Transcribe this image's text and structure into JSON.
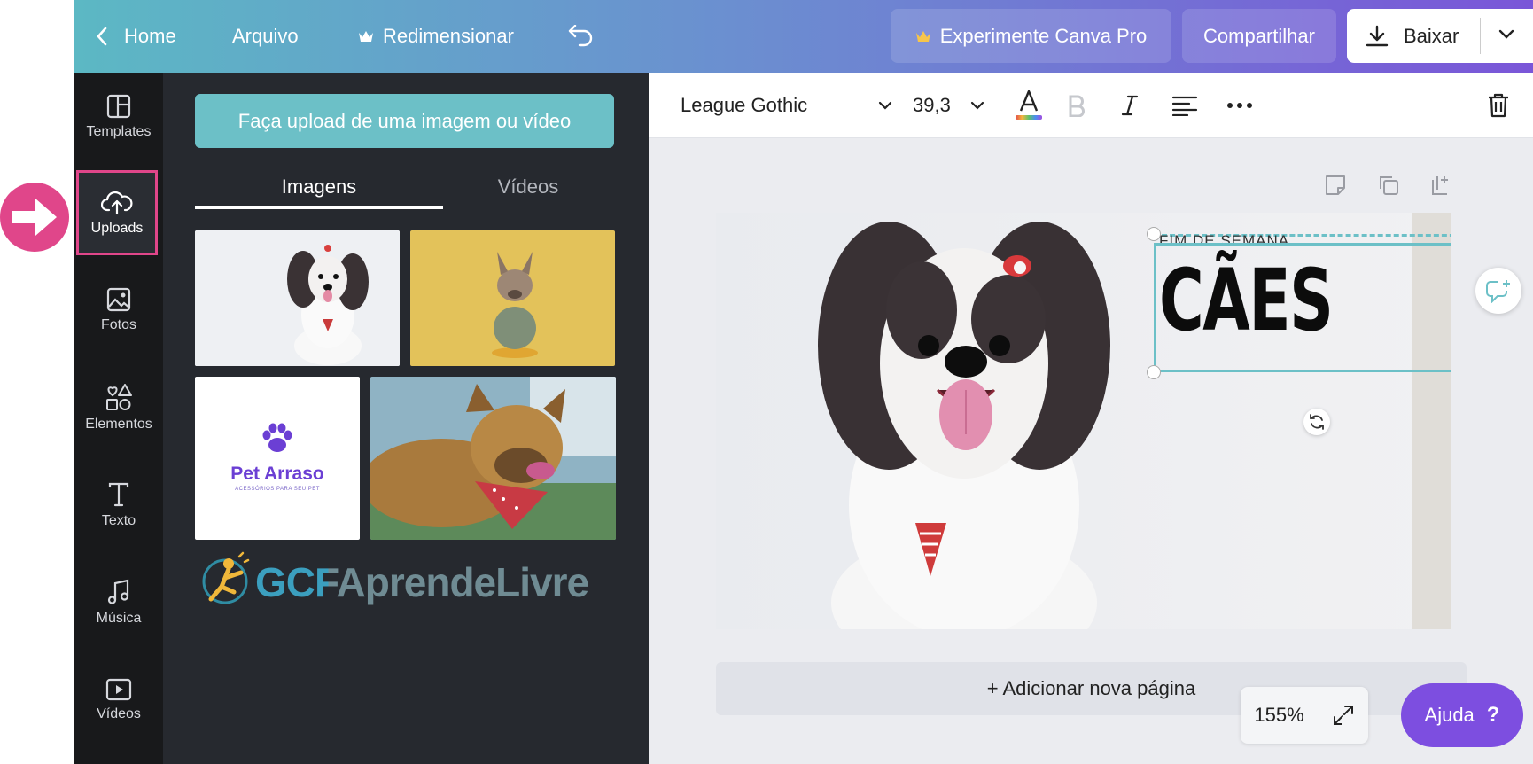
{
  "topbar": {
    "home": "Home",
    "file": "Arquivo",
    "resize": "Redimensionar",
    "try_pro": "Experimente Canva Pro",
    "share": "Compartilhar",
    "download": "Baixar"
  },
  "sidebar": {
    "items": [
      {
        "label": "Templates"
      },
      {
        "label": "Uploads"
      },
      {
        "label": "Fotos"
      },
      {
        "label": "Elementos"
      },
      {
        "label": "Texto"
      },
      {
        "label": "Música"
      },
      {
        "label": "Vídeos"
      }
    ],
    "active": "Uploads"
  },
  "panel": {
    "upload_button": "Faça upload de uma imagem ou vídeo",
    "tabs": [
      {
        "label": "Imagens"
      },
      {
        "label": "Vídeos"
      }
    ],
    "active_tab": "Imagens",
    "logo_name": "Pet Arraso",
    "logo_tagline": "ACESSÓRIOS PARA SEU PET",
    "watermark": "GCFAprendeLivre"
  },
  "toolbar": {
    "font": "League Gothic",
    "font_size": "39,3"
  },
  "design": {
    "subtitle": "FIM DE SEMANA",
    "title": "CÃES"
  },
  "canvas": {
    "add_page": "+ Adicionar nova página",
    "zoom": "155%"
  },
  "help": {
    "label": "Ajuda",
    "mark": "?"
  },
  "colors": {
    "accent_pink": "#e0468a",
    "upload_teal": "#6cc0c7",
    "help_purple": "#7d4ee0",
    "logo_purple": "#6b3fd4"
  }
}
